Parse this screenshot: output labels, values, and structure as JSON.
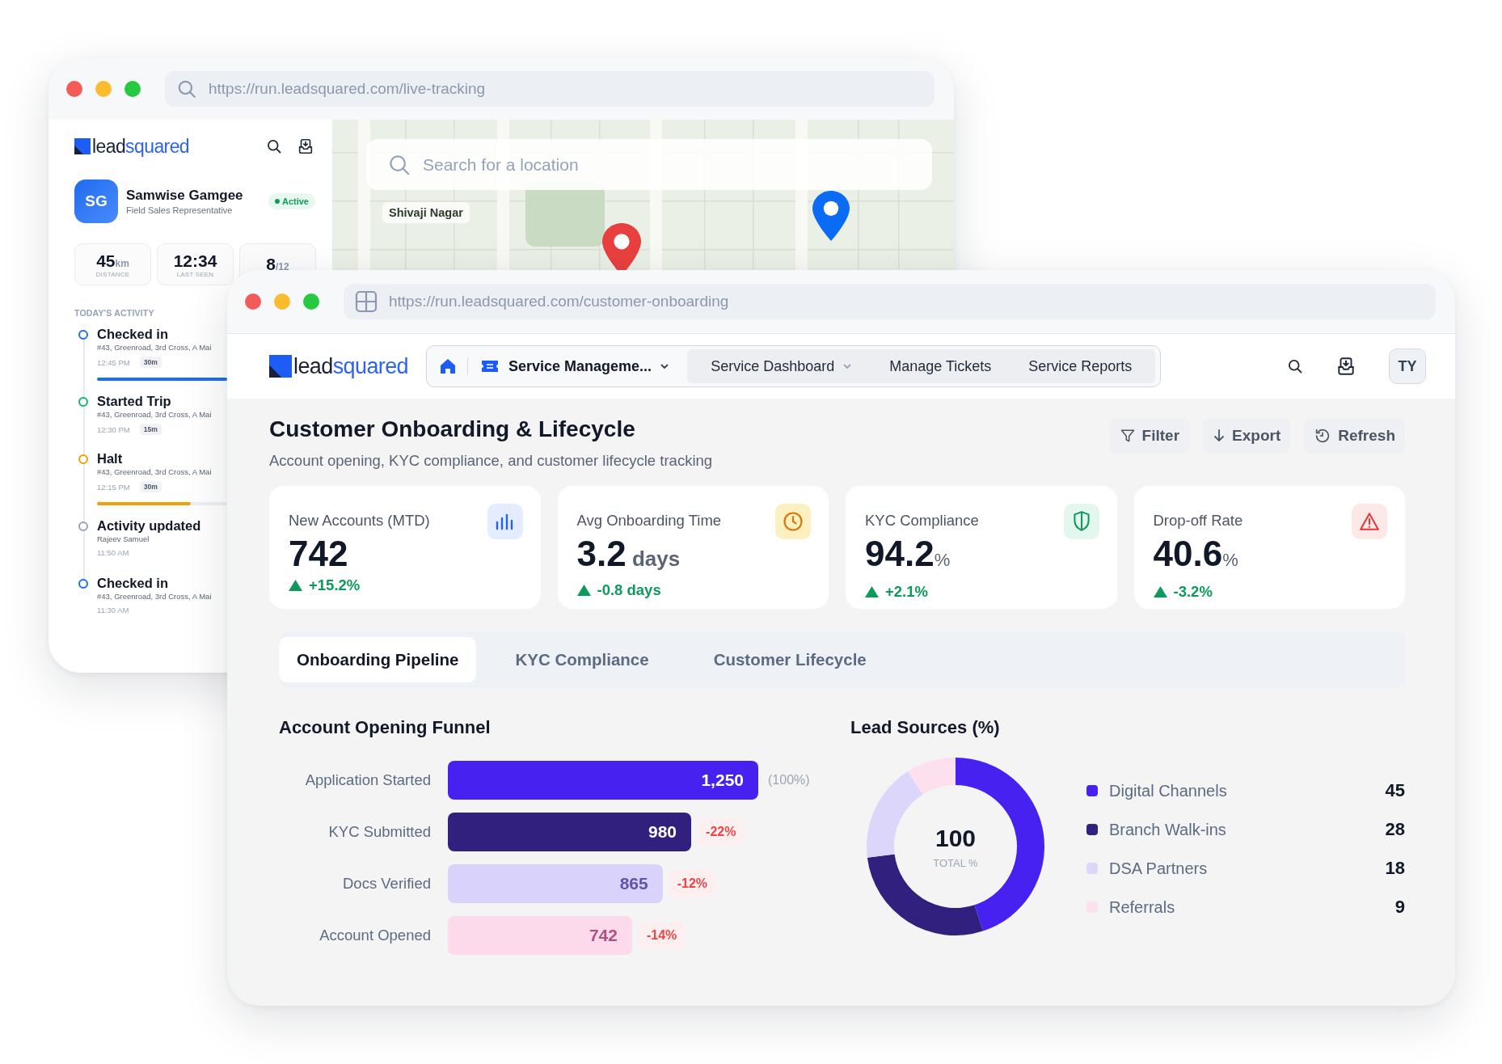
{
  "back_window": {
    "url": "https://run.leadsquared.com/live-tracking",
    "logo": {
      "dark": "lead",
      "accent": "squared"
    },
    "profile": {
      "initials": "SG",
      "name": "Samwise Gamgee",
      "role": "Field Sales Representative",
      "status": "Active"
    },
    "stats": [
      {
        "value": "45",
        "unit": "km",
        "label": "DISTANCE"
      },
      {
        "value": "12:34",
        "label": "LAST SEEN"
      },
      {
        "value": "8",
        "unit": "/12"
      }
    ],
    "activity_heading": "TODAY'S ACTIVITY",
    "activity": [
      {
        "title": "Checked in",
        "detail": "#43, Greenroad, 3rd Cross, A Mai",
        "time": "12:45 PM",
        "duration": "30m",
        "color": "#1a6ef5",
        "level": 1
      },
      {
        "title": "Started Trip",
        "detail": "#43, Greenroad, 3rd Cross, A Mai",
        "time": "12:30 PM",
        "duration": "15m",
        "color": "#12b76a"
      },
      {
        "title": "Halt",
        "detail": "#43, Greenroad, 3rd Cross, A Mai",
        "time": "12:15 PM",
        "duration": "30m",
        "color": "#f59e0b",
        "level": 0.72
      },
      {
        "title": "Activity updated",
        "detail": "Rajeev Samuel",
        "time": "11:50 AM",
        "color": "#94a3b8"
      },
      {
        "title": "Checked in",
        "detail": "#43, Greenroad, 3rd Cross, A Mai",
        "time": "11:30 AM",
        "color": "#1a6ef5"
      }
    ],
    "map": {
      "placeholder": "Search for a location",
      "place_label": "Shivaji Nagar",
      "pins": [
        {
          "color": "#e8403f"
        },
        {
          "color": "#0a6cf5"
        }
      ]
    }
  },
  "front_window": {
    "url": "https://run.leadsquared.com/customer-onboarding",
    "logo": {
      "dark": "lead",
      "accent": "squared"
    },
    "nav": {
      "module": "Service Manageme...",
      "items": [
        {
          "label": "Service Dashboard",
          "dropdown": true
        },
        {
          "label": "Manage Tickets",
          "dropdown": false
        },
        {
          "label": "Service Reports",
          "dropdown": false
        }
      ]
    },
    "avatar": "TY",
    "title": "Customer Onboarding & Lifecycle",
    "subtitle": "Account opening, KYC compliance, and customer lifecycle tracking",
    "actions": [
      {
        "label": "Filter",
        "kind": "filter"
      },
      {
        "label": "Export",
        "kind": "export"
      },
      {
        "label": "Refresh",
        "kind": "refresh"
      }
    ],
    "kpis": [
      {
        "label": "New Accounts (MTD)",
        "value": "742",
        "change": "+15.2%",
        "kind": "chart"
      },
      {
        "label": "Avg Onboarding Time",
        "value": "3.2",
        "unit": "days",
        "change": "-0.8 days",
        "kind": "clock"
      },
      {
        "label": "KYC Compliance",
        "value": "94.2",
        "unit": "%",
        "change": "+2.1%",
        "kind": "shield"
      },
      {
        "label": "Drop-off Rate",
        "value": "40.6",
        "unit": "%",
        "change": "-3.2%",
        "kind": "alert"
      }
    ],
    "tabs": [
      {
        "label": "Onboarding Pipeline",
        "selected": true
      },
      {
        "label": "KYC Compliance",
        "selected": false
      },
      {
        "label": "Customer Lifecycle",
        "selected": false
      }
    ],
    "funnel": {
      "title": "Account Opening Funnel",
      "rows": [
        {
          "label": "Application Started",
          "value": "1,250",
          "change": "(100%)",
          "kind": "base",
          "color": "#4621f0"
        },
        {
          "label": "KYC Submitted",
          "value": "980",
          "change": "-22%",
          "kind": "drop",
          "color": "#32207f"
        },
        {
          "label": "Docs Verified",
          "value": "865",
          "change": "-12%",
          "kind": "drop",
          "color": "#d9d3fc"
        },
        {
          "label": "Account Opened",
          "value": "742",
          "change": "-14%",
          "kind": "drop",
          "color": "#fdd9ec"
        }
      ]
    },
    "lead_sources": {
      "title": "Lead Sources (%)",
      "center_value": "100",
      "center_label": "TOTAL %",
      "legend": [
        {
          "value": "45",
          "color": "#4621f0"
        },
        {
          "value": "28",
          "color": "#32207f"
        },
        {
          "value": "18",
          "color": "#ddd6fb"
        },
        {
          "value": "9",
          "color": "#fde0ee"
        }
      ],
      "chart_data": {
        "type": "donut",
        "categories": [
          "Digital Channels",
          "Branch Walk-ins",
          "DSA Partners",
          "Referrals"
        ],
        "values": [
          45,
          28,
          18,
          9
        ]
      }
    }
  }
}
